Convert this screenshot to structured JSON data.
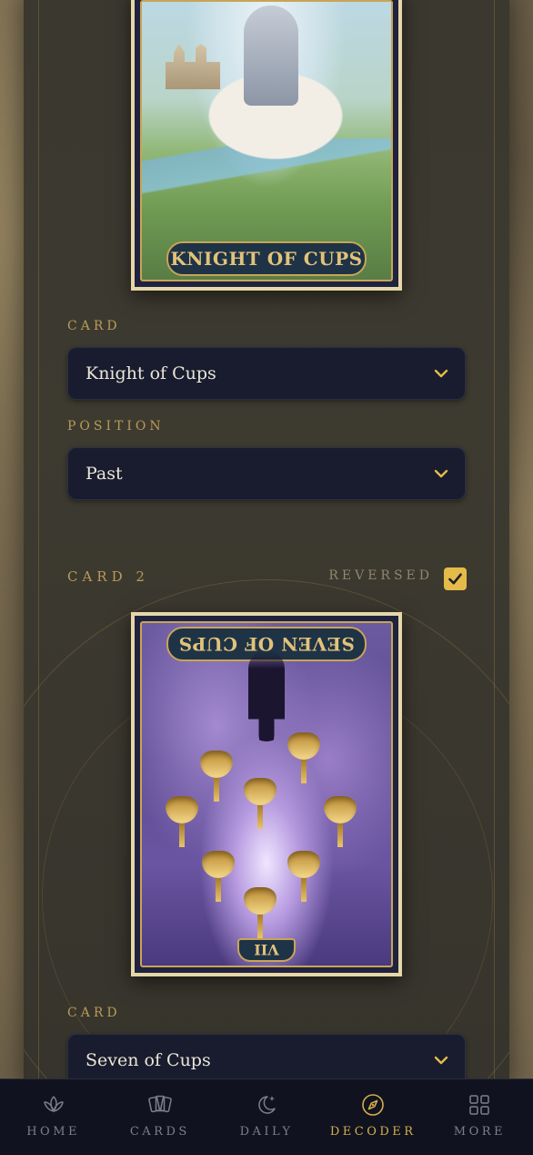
{
  "card1": {
    "title": "KNIGHT OF CUPS",
    "card_label": "CARD",
    "card_value": "Knight of Cups",
    "position_label": "POSITION",
    "position_value": "Past"
  },
  "card2": {
    "section_title": "CARD 2",
    "reversed_label": "REVERSED",
    "reversed": true,
    "title": "SEVEN OF CUPS",
    "numeral": "VII",
    "card_label": "CARD",
    "card_value": "Seven of Cups"
  },
  "nav": {
    "items": [
      {
        "label": "HOME",
        "icon": "lotus-icon"
      },
      {
        "label": "CARDS",
        "icon": "cards-icon"
      },
      {
        "label": "DAILY",
        "icon": "moon-star-icon"
      },
      {
        "label": "DECODER",
        "icon": "compass-icon",
        "active": true
      },
      {
        "label": "MORE",
        "icon": "grid-icon"
      }
    ]
  },
  "colors": {
    "accent": "#d6ad4d",
    "select_bg": "#181c2e",
    "nav_bg": "#10131f",
    "label_gold": "#b99a58"
  }
}
